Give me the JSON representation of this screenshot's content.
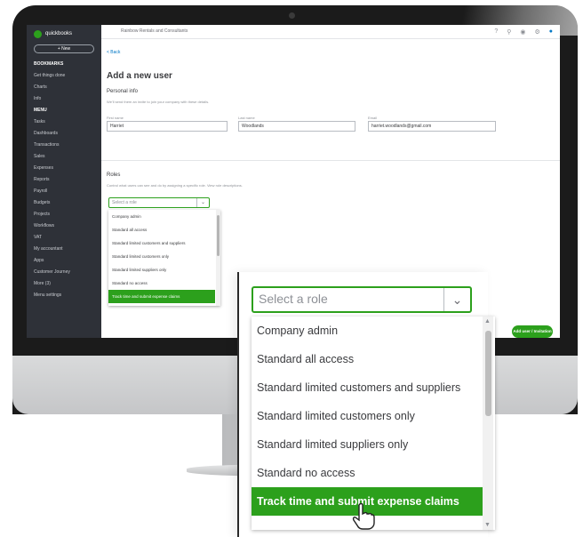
{
  "app": {
    "company": "Rainbow Rentals and Consultants",
    "logo_text": "quickbooks"
  },
  "sidebar": {
    "new_label": "+ New",
    "items": [
      {
        "label": "BOOKMARKS",
        "head": true
      },
      {
        "label": "Get things done",
        "head": false
      },
      {
        "label": "Charts",
        "head": false
      },
      {
        "label": "Info",
        "head": false
      },
      {
        "label": "MENU",
        "head": true
      },
      {
        "label": "Tasks",
        "head": false
      },
      {
        "label": "Dashboards",
        "head": false
      },
      {
        "label": "Transactions",
        "head": false
      },
      {
        "label": "Sales",
        "head": false
      },
      {
        "label": "Expenses",
        "head": false
      },
      {
        "label": "Reports",
        "head": false
      },
      {
        "label": "Payroll",
        "head": false
      },
      {
        "label": "Budgets",
        "head": false
      },
      {
        "label": "Projects",
        "head": false
      },
      {
        "label": "Workflows",
        "head": false
      },
      {
        "label": "VAT",
        "head": false
      },
      {
        "label": "My accountant",
        "head": false
      },
      {
        "label": "Apps",
        "head": false
      },
      {
        "label": "Customer Journey",
        "head": false
      },
      {
        "label": "More (3)",
        "head": false
      },
      {
        "label": "Menu settings",
        "head": false
      }
    ]
  },
  "form": {
    "back": "< Back",
    "title": "Add a new user",
    "personal_title": "Personal info",
    "personal_sub": "We'll send them an invite to join your company with these details.",
    "first_name_label": "First name",
    "first_name": "Harriet",
    "last_name_label": "Last name",
    "last_name": "Woodlands",
    "email_label": "Email",
    "email": "harriet.woodlands@gmail.com",
    "roles_title": "Roles",
    "roles_sub": "Control what users can see and do by assigning a specific role. View role descriptions.",
    "select_placeholder": "Select a role",
    "add_button": "Add user / Invitation"
  },
  "roles": [
    "Company admin",
    "Standard all access",
    "Standard limited customers and suppliers",
    "Standard limited customers only",
    "Standard limited suppliers only",
    "Standard no access",
    "Track time and submit expense claims"
  ],
  "selected_role_index": 6,
  "colors": {
    "accent": "#2ca01c",
    "sidebar": "#2e3138"
  }
}
